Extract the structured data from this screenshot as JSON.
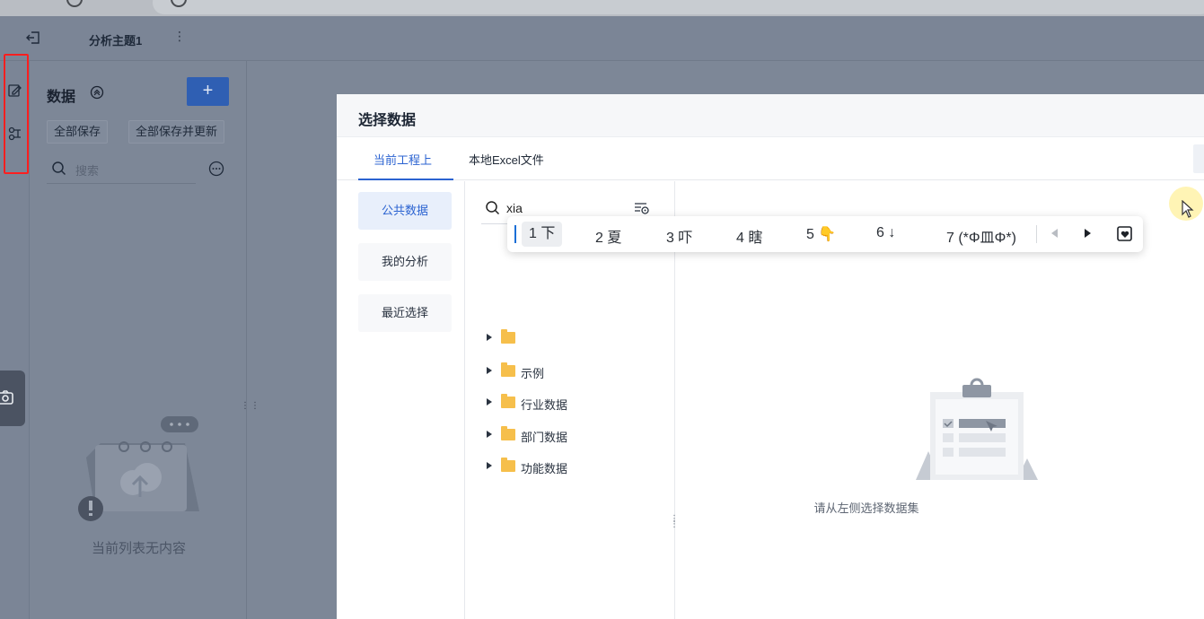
{
  "app": {
    "topbar": {
      "title": "分析主题1",
      "more": "⋮"
    }
  },
  "data_panel": {
    "heading": "数据",
    "add_label": "+",
    "save_all": "全部保存",
    "save_all_update": "全部保存并更新",
    "search_placeholder": "搜索",
    "empty_text": "当前列表无内容"
  },
  "modal": {
    "title": "选择数据",
    "tabs": [
      {
        "label": "当前工程上",
        "active": true
      },
      {
        "label": "本地Excel文件",
        "active": false
      }
    ],
    "sidenav": [
      {
        "label": "公共数据",
        "active": true
      },
      {
        "label": "我的分析",
        "active": false
      },
      {
        "label": "最近选择",
        "active": false
      }
    ],
    "search_value": "xia",
    "tree": [
      {
        "label": "示例"
      },
      {
        "label": "行业数据"
      },
      {
        "label": "部门数据"
      },
      {
        "label": "功能数据"
      }
    ],
    "empty_hint": "请从左侧选择数据集"
  },
  "ime": {
    "candidates": [
      "1 下",
      "2 夏",
      "3 吓",
      "4 瞎",
      "5 👇",
      "6 ↓",
      "7 (*Φ皿Φ*)"
    ]
  },
  "colors": {
    "accent": "#2b63d1",
    "highlight": "#ff1f1f",
    "folder": "#f6bf4b"
  }
}
